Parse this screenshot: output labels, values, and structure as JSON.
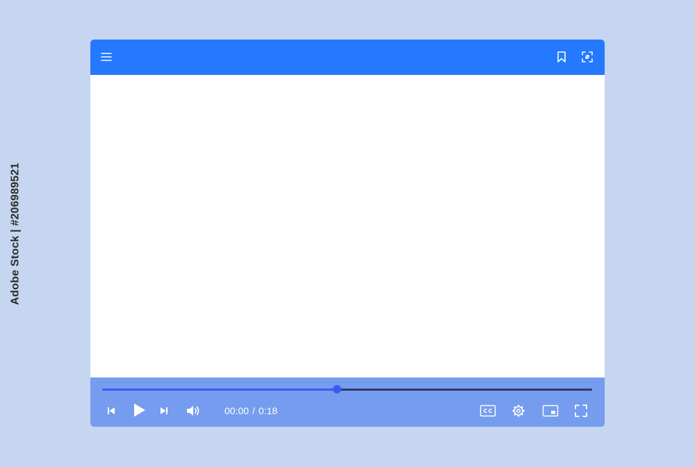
{
  "watermark": {
    "text": "Adobe Stock | #206989521"
  },
  "top_bar": {
    "color": "#2479ff",
    "icons": [
      "menu-icon",
      "bookmark-icon",
      "expand-icon"
    ]
  },
  "player": {
    "current_time": "00:00",
    "separator": "/",
    "duration": "0:18",
    "progress_percent": 48,
    "colors": {
      "control_bar": "#759cee",
      "progress_played": "#3b5bf2",
      "progress_remaining": "#2f3a66"
    },
    "controls": [
      "previous-icon",
      "play-icon",
      "next-icon",
      "volume-icon",
      "captions-icon",
      "settings-icon",
      "picture-in-picture-icon",
      "fullscreen-icon"
    ]
  }
}
